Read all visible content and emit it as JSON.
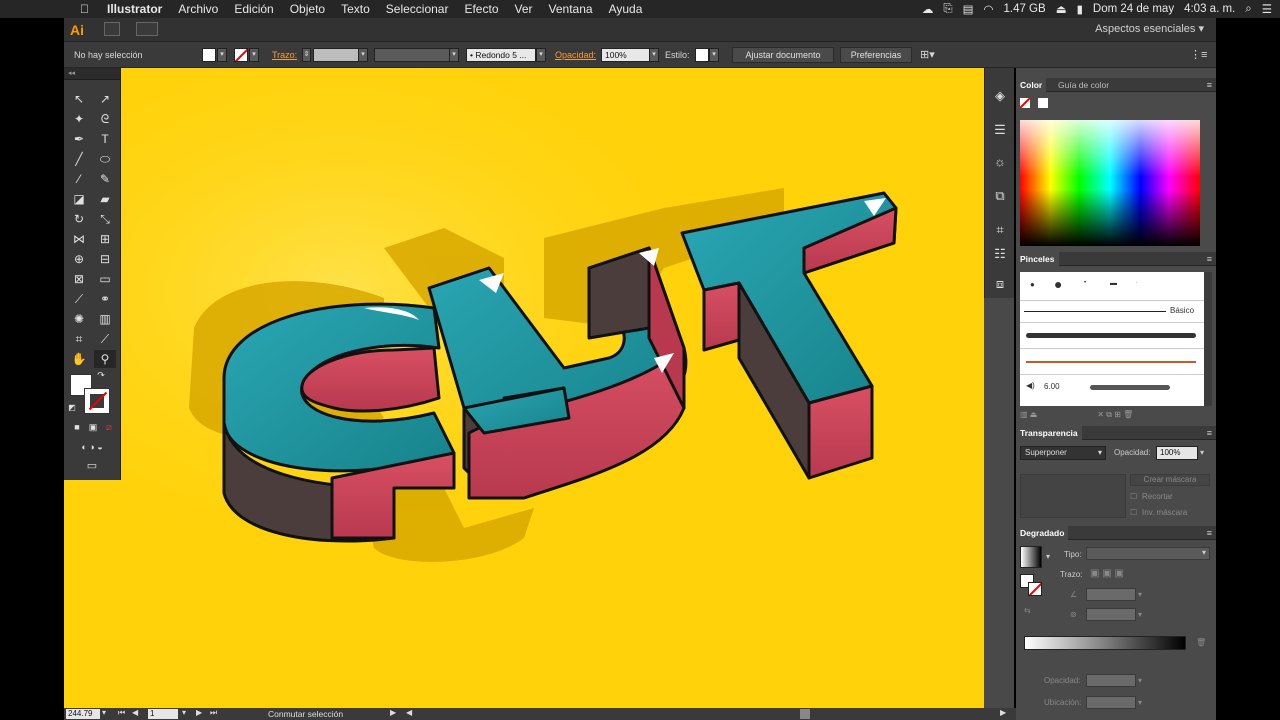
{
  "menubar": {
    "apple": "",
    "app_name": "Illustrator",
    "items": [
      "Archivo",
      "Edición",
      "Objeto",
      "Texto",
      "Seleccionar",
      "Efecto",
      "Ver",
      "Ventana",
      "Ayuda"
    ],
    "memory": "1.47 GB",
    "date": "Dom 24 de may",
    "time": "4:03 a. m."
  },
  "appbar": {
    "logo": "Ai",
    "workspace": "Aspectos esenciales"
  },
  "control_bar": {
    "selection": "No hay selección",
    "stroke_label": "Trazo:",
    "brush_label": "Redondo 5 ...",
    "opacity_label": "Opacidad:",
    "opacity_value": "100%",
    "style_label": "Estilo:",
    "fit_button": "Ajustar documento",
    "prefs_button": "Preferencias"
  },
  "status_bar": {
    "zoom": "244.79",
    "page": "1",
    "status": "Conmutar selección"
  },
  "panels": {
    "color_tab": "Color",
    "color_guide_tab": "Guía de color",
    "brushes_tab": "Pinceles",
    "brush_basic": "Básico",
    "brush_size": "6.00",
    "transparency_tab": "Transparencia",
    "blend_mode": "Superponer",
    "opacity_label": "Opacidad:",
    "opacity_value": "100%",
    "make_mask": "Crear máscara",
    "clip": "Recortar",
    "invert_mask": "Inv. máscara",
    "gradient_tab": "Degradado",
    "type_label": "Tipo:",
    "stroke_label": "Trazo:",
    "opacity2_label": "Opacidad:",
    "location_label": "Ubicación:"
  },
  "artwork": {
    "text": "CUT",
    "colors": {
      "background": "#ffd20a",
      "teal": "#1e9196",
      "pink": "#c9475b",
      "side_dark": "#4a3b3b",
      "shadow": "#d9aa00",
      "outline": "#111111"
    }
  }
}
